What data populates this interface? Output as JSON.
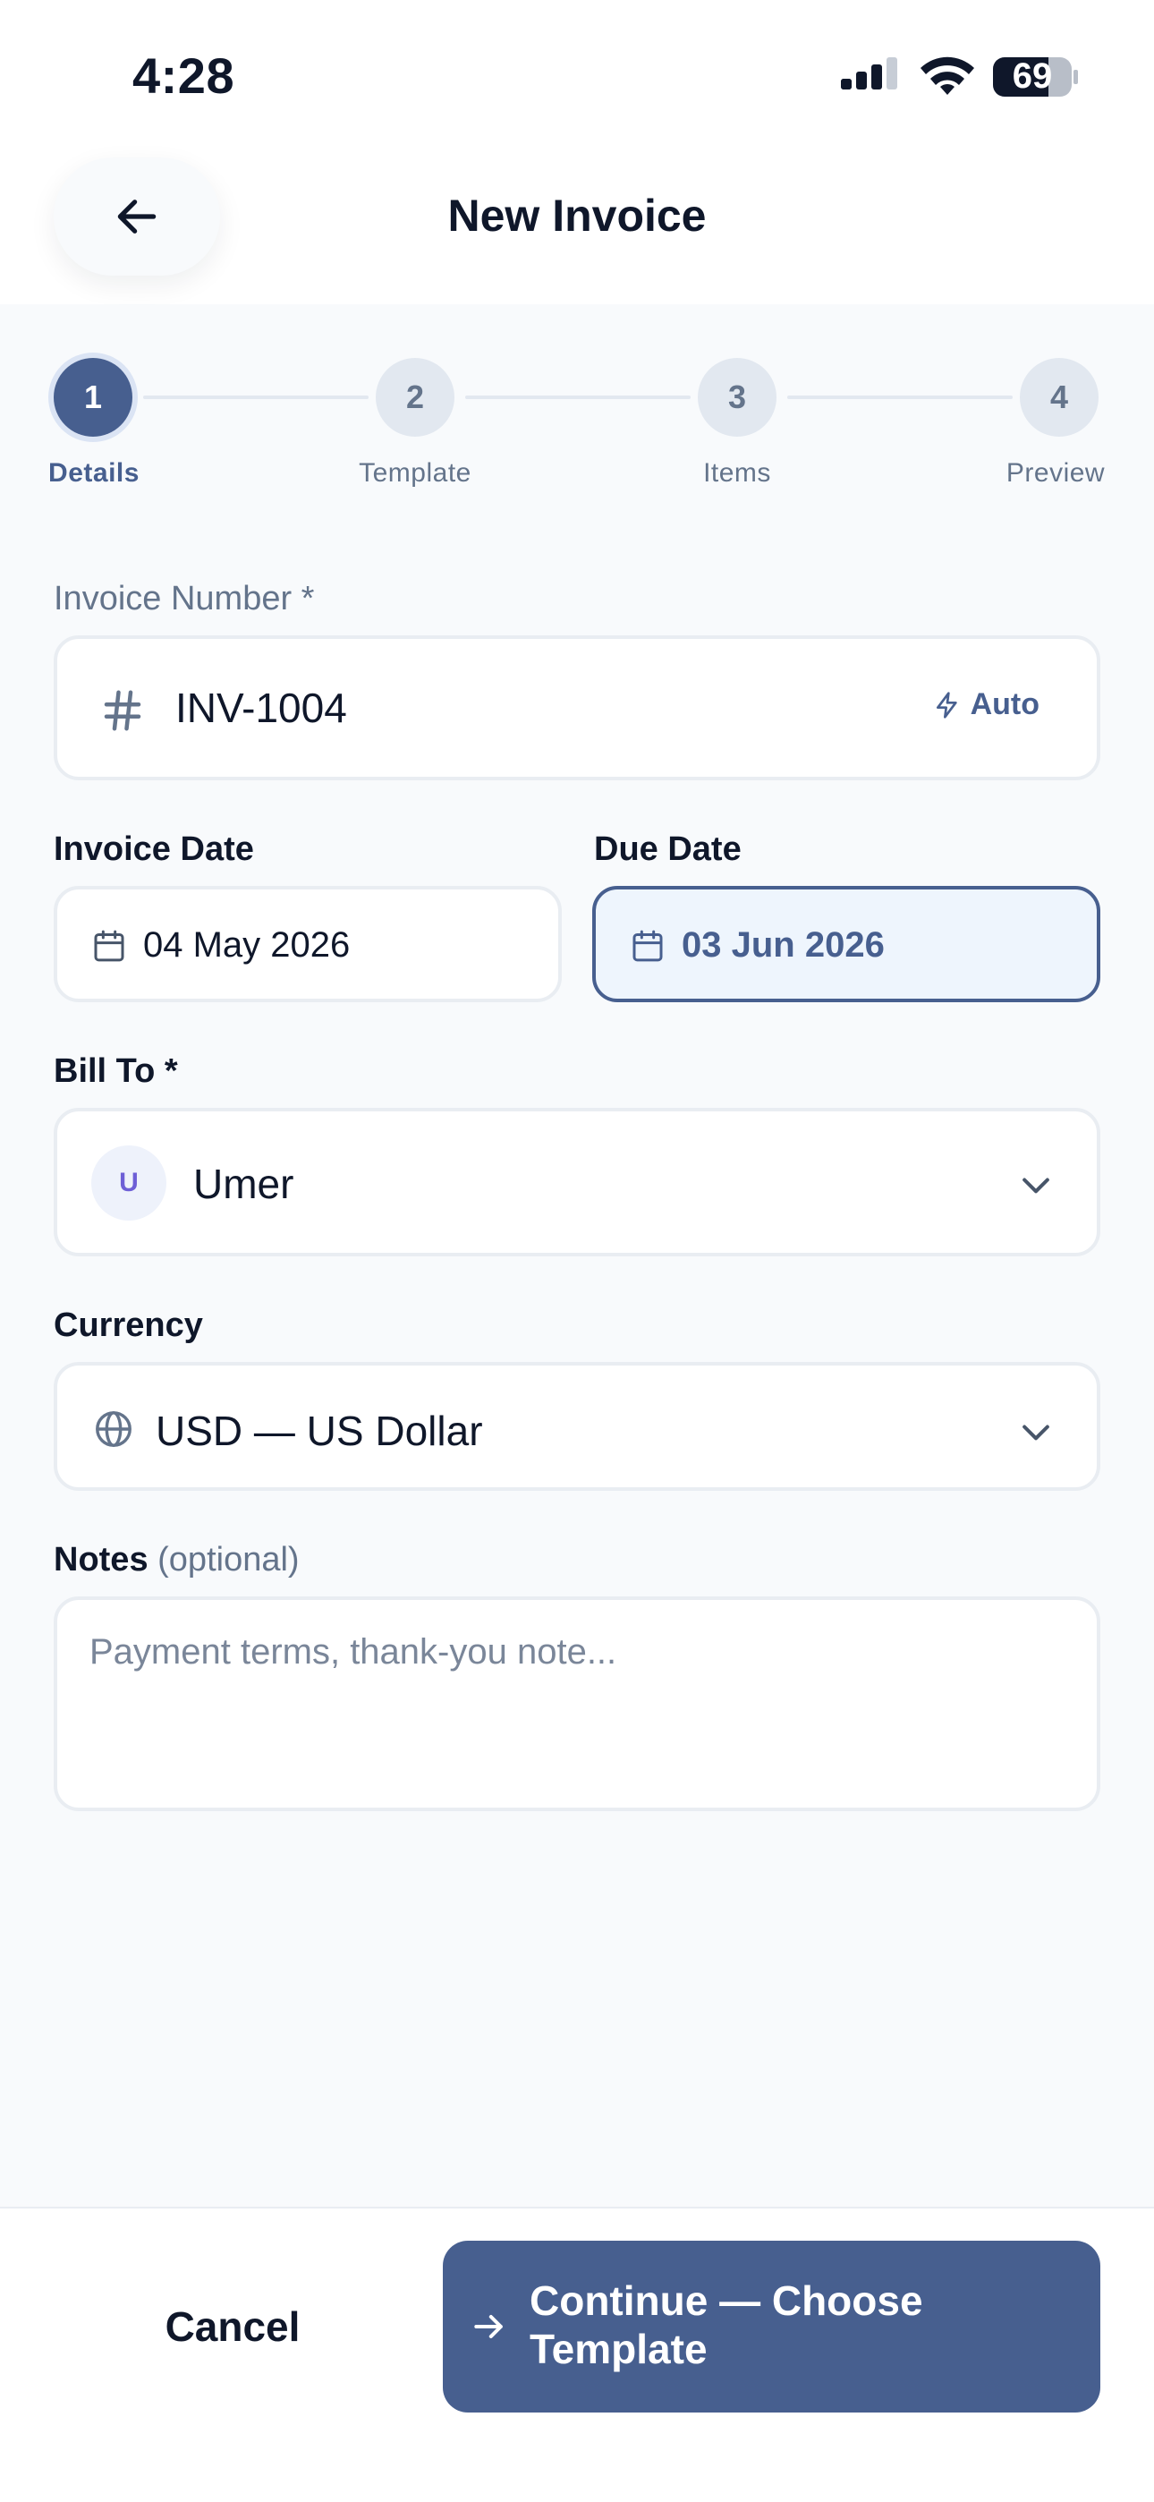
{
  "status_bar": {
    "time": "4:28",
    "battery": "69"
  },
  "header": {
    "title": "New Invoice",
    "back_icon": "arrow-left-icon"
  },
  "stepper": {
    "steps": [
      {
        "number": "1",
        "label": "Details",
        "active": true
      },
      {
        "number": "2",
        "label": "Template",
        "active": false
      },
      {
        "number": "3",
        "label": "Items",
        "active": false
      },
      {
        "number": "4",
        "label": "Preview",
        "active": false
      }
    ]
  },
  "form": {
    "invoice_number": {
      "label": "Invoice Number *",
      "value": "INV-1004",
      "auto_label": "Auto"
    },
    "invoice_date": {
      "label": "Invoice Date",
      "value": "04 May 2026"
    },
    "due_date": {
      "label": "Due Date",
      "value": "03 Jun 2026"
    },
    "bill_to": {
      "label": "Bill To *",
      "avatar_initial": "U",
      "value": "Umer"
    },
    "currency": {
      "label": "Currency",
      "value": "USD — US Dollar"
    },
    "notes": {
      "label": "Notes",
      "optional": "(optional)",
      "placeholder": "Payment terms, thank-you note..."
    }
  },
  "footer": {
    "cancel_label": "Cancel",
    "continue_label": "Continue — Choose Template"
  },
  "colors": {
    "accent": "#475f8f",
    "focus_bg": "#eef5fd",
    "border": "#e9edf2",
    "muted_text": "#64748b"
  }
}
